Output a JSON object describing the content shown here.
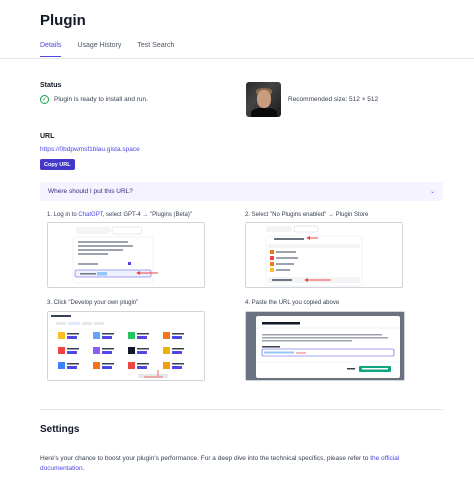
{
  "title": "Plugin",
  "tabs": [
    "Details",
    "Usage History",
    "Test Search"
  ],
  "status": {
    "label": "Status",
    "text": "Plugin is ready to install and run."
  },
  "recommended_size": "Recommended size: 512 × 512",
  "url": {
    "label": "URL",
    "value": "https://0bdpwmsf1blau.gista.space",
    "copy_label": "Copy URL"
  },
  "accordion": {
    "question": "Where should I put this URL?"
  },
  "steps": {
    "s1_prefix": "1. Log in to ",
    "s1_link": "ChatGPT",
    "s1_suffix": ", select GPT-4 → \"Plugins (Beta)\"",
    "s2": "2. Select \"No Plugins enabled\" → Plugin Store",
    "s3": "3. Click \"Develop your own plugin\"",
    "s4": "4. Paste the URL you copied above"
  },
  "settings": {
    "heading": "Settings",
    "text_prefix": "Here's your chance to boost your plugin's performance. For a deep dive into the technical specifics, please refer to ",
    "link": "the official documentation",
    "text_suffix": "."
  },
  "colors": {
    "accent": "#4f46e5",
    "success": "#16a34a",
    "accordion_bg": "#f5f3ff"
  },
  "icons": [
    "check-circle-icon",
    "chevron-down-icon"
  ]
}
